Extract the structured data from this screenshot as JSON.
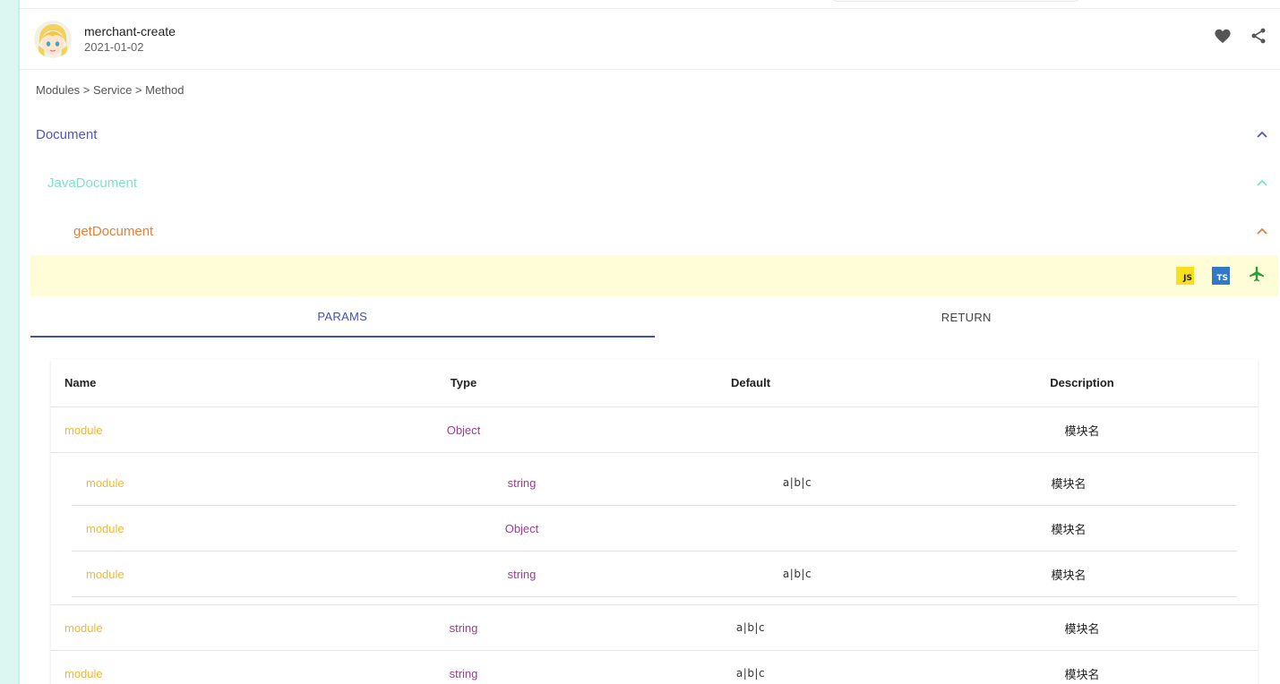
{
  "header": {
    "title": "merchant-create",
    "date": "2021-01-02",
    "actions": [
      "heart-icon",
      "share-icon"
    ]
  },
  "breadcrumb": "Modules > Service > Method",
  "tree": {
    "level0": "Document",
    "level1": "JavaDocument",
    "level2": "getDocument"
  },
  "toolbar": {
    "js_label": "JS",
    "ts_label": "TS",
    "icons": [
      "js-icon",
      "ts-icon",
      "airplane-icon"
    ]
  },
  "tabs": [
    {
      "label": "PARAMS",
      "active": true
    },
    {
      "label": "RETURN",
      "active": false
    }
  ],
  "table": {
    "headers": [
      "Name",
      "Type",
      "Default",
      "Description"
    ],
    "rows": [
      {
        "name": "module",
        "type": "Object",
        "default": "",
        "description": "模块名"
      },
      {
        "name": "module",
        "type": "string",
        "default": "a|b|c",
        "description": "模块名"
      },
      {
        "name": "module",
        "type": "string",
        "default": "a|b|c",
        "description": "模块名"
      }
    ],
    "nested": [
      {
        "name": "module",
        "type": "string",
        "default": "a|b|c",
        "description": "模块名"
      },
      {
        "name": "module",
        "type": "Object",
        "default": "",
        "description": "模块名"
      },
      {
        "name": "module",
        "type": "string",
        "default": "a|b|c",
        "description": "模块名"
      }
    ]
  },
  "colors": {
    "accent": "#3f51b5",
    "tree_level0": "#4f56c0",
    "tree_level1": "#7de1c9",
    "tree_level2": "#e6803a",
    "name": "#f5b82e",
    "type": "#9c3d8e",
    "toolbar_bg": "#fefdd8",
    "left_rail": "#dcf7f1"
  }
}
